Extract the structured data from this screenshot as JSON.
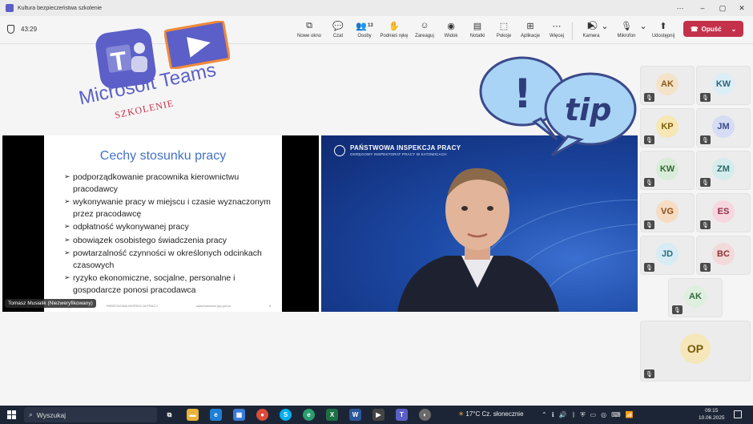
{
  "window": {
    "title": "Kultura bezpieczeństwa szkolenie",
    "minimize": "⋯",
    "controls": [
      "–",
      "▢",
      "✕"
    ]
  },
  "meeting": {
    "timer": "43:29",
    "toolbar": [
      {
        "id": "new-window",
        "label": "Nowe okno",
        "icon": "open-window-icon"
      },
      {
        "id": "chat",
        "label": "Czat",
        "icon": "chat-icon"
      },
      {
        "id": "people",
        "label": "Osoby",
        "icon": "people-icon",
        "count": "13"
      },
      {
        "id": "raise-hand",
        "label": "Podnieś rękę",
        "icon": "hand-icon"
      },
      {
        "id": "react",
        "label": "Zareaguj",
        "icon": "smile-icon"
      },
      {
        "id": "view",
        "label": "Widok",
        "icon": "view-icon"
      },
      {
        "id": "notes",
        "label": "Notatki",
        "icon": "notes-icon"
      },
      {
        "id": "rooms",
        "label": "Pokoje",
        "icon": "rooms-icon"
      },
      {
        "id": "apps",
        "label": "Aplikacje",
        "icon": "apps-icon"
      },
      {
        "id": "more",
        "label": "Więcej",
        "icon": "more-icon"
      },
      {
        "id": "camera",
        "label": "Kamera",
        "icon": "camera-off-icon"
      },
      {
        "id": "mic",
        "label": "Mikrofon",
        "icon": "mic-off-icon"
      },
      {
        "id": "share",
        "label": "Udostępnij",
        "icon": "share-icon"
      }
    ],
    "leave_label": "Opuść",
    "leave_color": "#c4314b"
  },
  "branding": {
    "teams_text": "Microsoft Teams",
    "szkolenie": "SZKOLENIE"
  },
  "slide": {
    "title": "Cechy stosunku pracy",
    "bullets": [
      "podporządkowanie pracownika kierownictwu pracodawcy",
      "wykonywanie pracy w miejscu i czasie wyznaczonym przez pracodawcę",
      "odpłatność wykonywanej pracy",
      "obowiązek osobistego świadczenia pracy",
      "powtarzalność czynności w określonych odcinkach czasowych",
      "ryzyko ekonomiczne, socjalne, personalne i gospodarcze ponosi pracodawca"
    ],
    "footer_left": "PAŃSTWOWA INSPEKCJA PRACY",
    "footer_mid": "www.katowice.pip.gov.pl",
    "footer_right": "9",
    "presenter": "Tomasz Musialik (Niezweryfikowany)"
  },
  "video": {
    "org": "PAŃSTWOWA INSPEKCJA PRACY",
    "org_sub": "OKRĘGOWY INSPEKTORAT PRACY W KATOWICACH"
  },
  "tip_text": "tip",
  "participants": [
    {
      "initials": "AK",
      "bg": "#f4e3c8",
      "fg": "#8a5a1c"
    },
    {
      "initials": "KW",
      "bg": "#dceef6",
      "fg": "#2a6681"
    },
    {
      "initials": "KP",
      "bg": "#f6e7b5",
      "fg": "#7a5c07"
    },
    {
      "initials": "JM",
      "bg": "#d6dcf3",
      "fg": "#3b4a8a"
    },
    {
      "initials": "KW",
      "bg": "#d9ebd9",
      "fg": "#2f6a2f"
    },
    {
      "initials": "ZM",
      "bg": "#d5ecec",
      "fg": "#2b6b6b"
    },
    {
      "initials": "VG",
      "bg": "#f6dcc2",
      "fg": "#8a4a14"
    },
    {
      "initials": "ES",
      "bg": "#f6d7df",
      "fg": "#8d2e47"
    },
    {
      "initials": "JD",
      "bg": "#d7ecf3",
      "fg": "#2a6a80"
    },
    {
      "initials": "BC",
      "bg": "#f3dada",
      "fg": "#8a3434"
    },
    {
      "initials": "AK",
      "bg": "#deefe0",
      "fg": "#2f6b3c"
    },
    {
      "initials": "OP",
      "bg": "#f6e7bb",
      "fg": "#7a5a07"
    }
  ],
  "taskbar": {
    "search_placeholder": "Wyszukaj",
    "weather": "17°C  Cz. słonecznie",
    "time": "09:15",
    "date": "10.06.2025",
    "apps": [
      {
        "name": "task-view-icon",
        "glyph": "⧉",
        "color": "#1c2536"
      },
      {
        "name": "file-explorer-icon",
        "glyph": "▬",
        "color": "#e8b33b"
      },
      {
        "name": "edge-icon",
        "glyph": "e",
        "color": "#1f7fd4"
      },
      {
        "name": "store-icon",
        "glyph": "▦",
        "color": "#3a7bd5"
      },
      {
        "name": "chrome-icon",
        "glyph": "●",
        "color": "#dd4b39"
      },
      {
        "name": "skype-icon",
        "glyph": "S",
        "color": "#00aff0"
      },
      {
        "name": "edge-dev-icon",
        "glyph": "e",
        "color": "#2a9d6f"
      },
      {
        "name": "excel-icon",
        "glyph": "X",
        "color": "#1d7044"
      },
      {
        "name": "word-icon",
        "glyph": "W",
        "color": "#2b579a"
      },
      {
        "name": "media-icon",
        "glyph": "▶",
        "color": "#444"
      },
      {
        "name": "teams-icon",
        "glyph": "T",
        "color": "#5b5fc7"
      },
      {
        "name": "paint-icon",
        "glyph": "◐",
        "color": "#6a6a6a"
      }
    ]
  }
}
